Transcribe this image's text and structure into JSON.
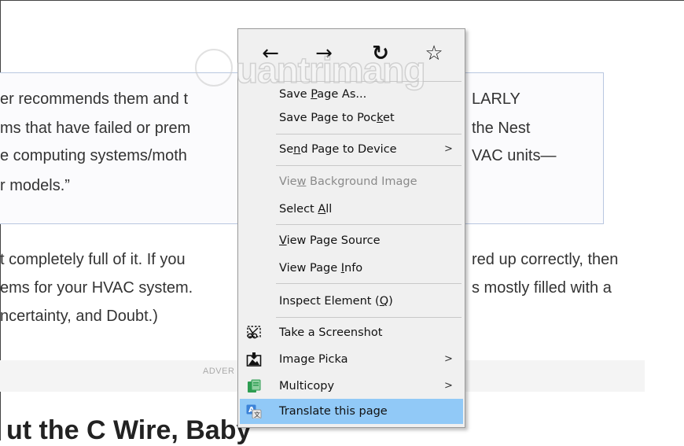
{
  "article": {
    "quote_lines": [
      "er recommends them and t",
      "ms that have failed or prem",
      "e computing systems/moth",
      "r models.”"
    ],
    "quote_right_fragments": [
      "LARLY",
      "the Nest",
      "VAC units—"
    ],
    "para_lines": [
      "t completely full of it. If you",
      "ems for your HVAC system.",
      "ncertainty, and Doubt.)"
    ],
    "para_right_fragments": [
      "red up correctly, then",
      "s mostly filled with a"
    ],
    "ad_label": "ADVER",
    "heading": "ut the C Wire, Baby"
  },
  "watermark": "uantrimang",
  "context_menu": {
    "nav": {
      "back_icon": "←",
      "forward_icon": "→",
      "reload_icon": "↻",
      "bookmark_icon": "☆"
    },
    "items": {
      "save_page_as": {
        "pre": "Save ",
        "key": "P",
        "post": "age As..."
      },
      "save_to_pocket": {
        "pre": "Save Page to Poc",
        "key": "k",
        "post": "et"
      },
      "send_to_device": {
        "pre": "Se",
        "key": "n",
        "post": "d Page to Device",
        "arrow": ">"
      },
      "view_background": {
        "pre": "Vie",
        "key": "w",
        "post": " Background Image"
      },
      "select_all": {
        "pre": "Select ",
        "key": "A",
        "post": "ll"
      },
      "view_source": {
        "pre": "",
        "key": "V",
        "post": "iew Page Source"
      },
      "view_info": {
        "pre": "View Page ",
        "key": "I",
        "post": "nfo"
      },
      "inspect": {
        "pre": "Inspect Element (",
        "key": "Q",
        "post": ")"
      },
      "screenshot": {
        "label": "Take a Screenshot"
      },
      "image_picka": {
        "label": "Image Picka",
        "arrow": ">"
      },
      "multicopy": {
        "label": "Multicopy",
        "arrow": ">"
      },
      "translate": {
        "label": "Translate this page"
      }
    },
    "highlight_color": "#91c9f7"
  }
}
